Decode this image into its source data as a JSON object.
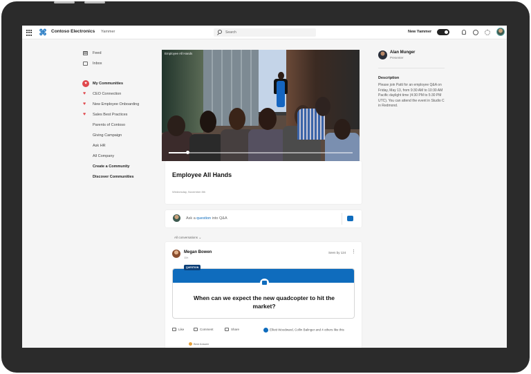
{
  "header": {
    "brand": "Contoso Electronics",
    "app_name": "Yammer",
    "search_placeholder": "Search",
    "new_yammer_label": "New Yammer"
  },
  "sidebar": {
    "items": [
      {
        "label": "Feed",
        "icon": "feed-icon"
      },
      {
        "label": "Inbox",
        "icon": "inbox-icon"
      },
      {
        "label": "My Communities",
        "icon": "community-icon"
      },
      {
        "label": "CEO Connection",
        "icon": "heart-icon"
      },
      {
        "label": "New Employee Onboarding",
        "icon": "heart-icon"
      },
      {
        "label": "Sales Best Practices",
        "icon": "heart-icon"
      },
      {
        "label": "Parents of Contoso",
        "icon": ""
      },
      {
        "label": "Giving Campaign",
        "icon": ""
      },
      {
        "label": "Ask HR",
        "icon": ""
      },
      {
        "label": "All Company",
        "icon": ""
      },
      {
        "label": "Create a Community",
        "icon": ""
      },
      {
        "label": "Discover Communities",
        "icon": ""
      }
    ]
  },
  "video": {
    "label": "Employee All Hands",
    "progress": 0.1
  },
  "event": {
    "title": "Employee All Hands",
    "date": "Wednesday, November 8th"
  },
  "qa": {
    "prefix": "Ask a ",
    "highlight": "question",
    "suffix": " into Q&A"
  },
  "conversations": {
    "filter_label": "All conversations",
    "post": {
      "author": "Megan Bowen",
      "time": "11h",
      "seen": "Seen by 124",
      "badge": "QUESTION",
      "question": "When can we expect the new quadcopter to hit the market?",
      "like": "Like",
      "comment": "Comment",
      "share": "Share",
      "reactions": "Elliott Woodward, Collin Balinger and 4 others like this",
      "best_answer": "Best Answer"
    }
  },
  "presenter": {
    "name": "Alan Munger",
    "role": "Presenter"
  },
  "description": {
    "title": "Description",
    "text": "Please join Patti for an employee Q&A on Friday, May 13, from 9:30 AM to 10:30 AM Pacific daylight time (4:30 PM to 5:30 PM UTC). You can attend the event in Studio C in Redmond."
  },
  "colors": {
    "accent": "#0f6cbd",
    "heart": "#e0474c"
  }
}
